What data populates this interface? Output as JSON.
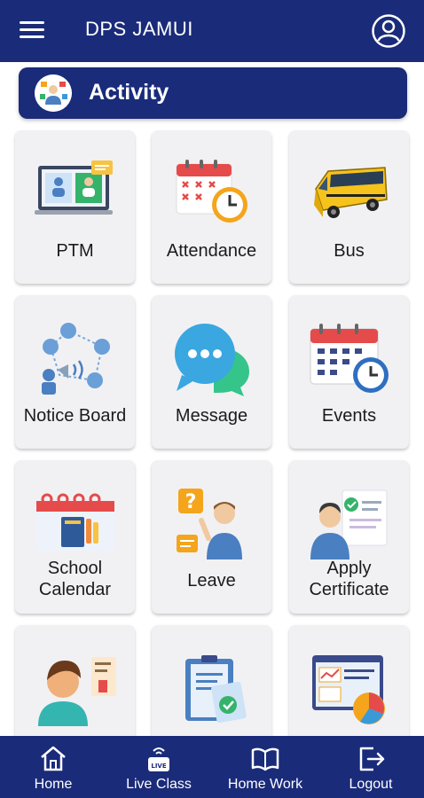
{
  "app": {
    "title": "DPS JAMUI"
  },
  "section": {
    "title": "Activity"
  },
  "tiles": [
    {
      "label": "PTM",
      "icon": "ptm-icon"
    },
    {
      "label": "Attendance",
      "icon": "attendance-icon"
    },
    {
      "label": "Bus",
      "icon": "bus-icon"
    },
    {
      "label": "Notice Board",
      "icon": "notice-board-icon"
    },
    {
      "label": "Message",
      "icon": "message-icon"
    },
    {
      "label": "Events",
      "icon": "events-icon"
    },
    {
      "label_line1": "School",
      "label_line2": "Calendar",
      "icon": "school-calendar-icon"
    },
    {
      "label": "Leave",
      "icon": "leave-icon"
    },
    {
      "label_line1": "Apply",
      "label_line2": "Certificate",
      "icon": "certificate-icon"
    },
    {
      "label": "",
      "icon": "student-profile-icon"
    },
    {
      "label": "",
      "icon": "report-icon"
    },
    {
      "label": "",
      "icon": "analytics-icon"
    }
  ],
  "bottom_nav": [
    {
      "label": "Home",
      "icon": "home-icon"
    },
    {
      "label": "Live Class",
      "icon": "live-class-icon"
    },
    {
      "label": "Home Work",
      "icon": "book-icon"
    },
    {
      "label": "Logout",
      "icon": "logout-icon"
    }
  ],
  "colors": {
    "primary": "#1a2b7a",
    "card_bg": "#f1f1f4"
  }
}
